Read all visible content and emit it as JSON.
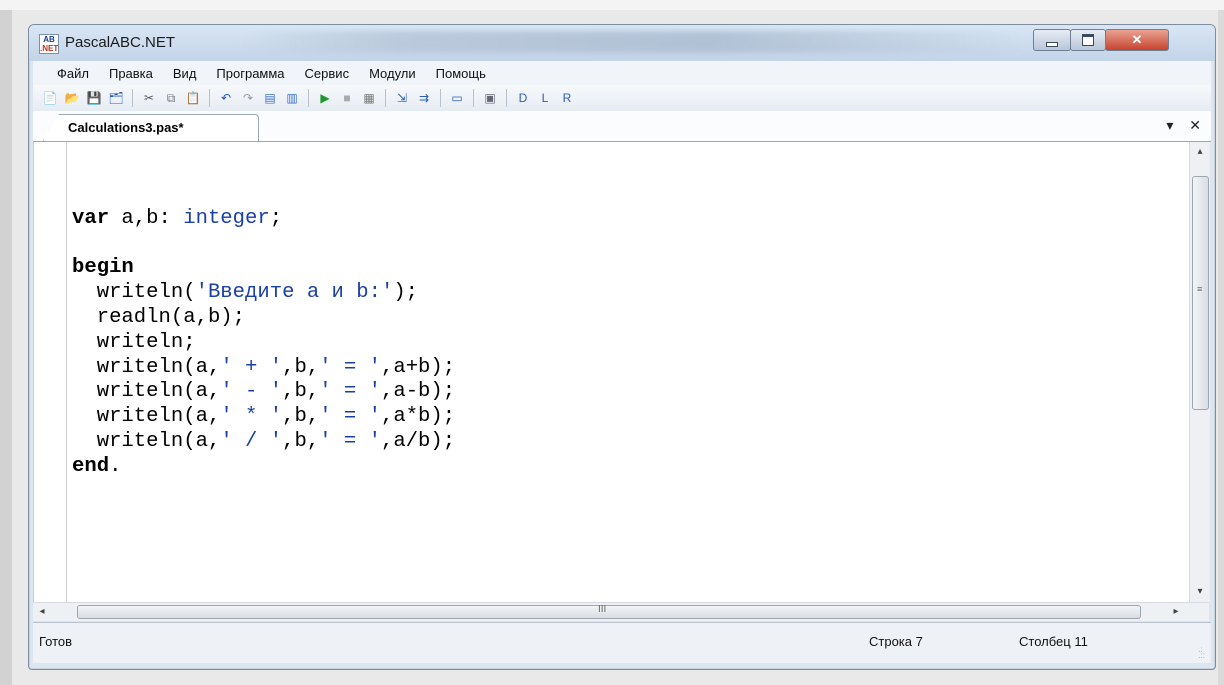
{
  "window": {
    "title": "PascalABC.NET",
    "icon_top": "AB",
    "icon_bottom": ".NET"
  },
  "controls": {
    "minimize": "minimize-icon",
    "maximize": "maximize-icon",
    "close": "✕"
  },
  "menu": [
    "Файл",
    "Правка",
    "Вид",
    "Программа",
    "Сервис",
    "Модули",
    "Помощь"
  ],
  "toolbar": [
    {
      "icon": "new-file-icon",
      "glyph": "📄",
      "color": "#d8b850"
    },
    {
      "icon": "open-folder-icon",
      "glyph": "📂",
      "color": "#d49a2a"
    },
    {
      "icon": "save-icon",
      "glyph": "💾",
      "color": "#2a5fb3"
    },
    {
      "icon": "save-all-icon",
      "glyph": "🗂",
      "color": "#2a5fb3"
    },
    {
      "sep": true
    },
    {
      "icon": "cut-icon",
      "glyph": "✂",
      "color": "#555"
    },
    {
      "icon": "copy-icon",
      "glyph": "⧉",
      "color": "#777"
    },
    {
      "icon": "paste-icon",
      "glyph": "📋",
      "color": "#a0722a"
    },
    {
      "sep": true
    },
    {
      "icon": "undo-icon",
      "glyph": "↶",
      "color": "#1d56c9"
    },
    {
      "icon": "redo-icon",
      "glyph": "↷",
      "color": "#999"
    },
    {
      "icon": "find-icon",
      "glyph": "▤",
      "color": "#3a6fd0"
    },
    {
      "icon": "replace-icon",
      "glyph": "▥",
      "color": "#3a6fd0"
    },
    {
      "sep": true
    },
    {
      "icon": "run-icon",
      "glyph": "▶",
      "color": "#1a9a2a"
    },
    {
      "icon": "stop-icon",
      "glyph": "■",
      "color": "#aaa"
    },
    {
      "icon": "compile-icon",
      "glyph": "▦",
      "color": "#777"
    },
    {
      "sep": true
    },
    {
      "icon": "step-into-icon",
      "glyph": "⇲",
      "color": "#2a5fb3"
    },
    {
      "icon": "step-over-icon",
      "glyph": "⇉",
      "color": "#2a5fb3"
    },
    {
      "sep": true
    },
    {
      "icon": "console-icon",
      "glyph": "▭",
      "color": "#2a5fb3"
    },
    {
      "sep": true
    },
    {
      "icon": "form-icon",
      "glyph": "▣",
      "color": "#667"
    },
    {
      "sep": true
    },
    {
      "icon": "debug-d-icon",
      "glyph": "D",
      "color": "#2a5fb3"
    },
    {
      "icon": "debug-l-icon",
      "glyph": "L",
      "color": "#2a5fb3"
    },
    {
      "icon": "debug-r-icon",
      "glyph": "R",
      "color": "#2a5fb3"
    }
  ],
  "tab": {
    "label": "Calculations3.pas*",
    "dropdown": "▾",
    "close": "✕"
  },
  "code": [
    [],
    [
      {
        "t": "var",
        "c": "kw"
      },
      {
        "t": " a,b: "
      },
      {
        "t": "integer",
        "c": "ty"
      },
      {
        "t": ";"
      }
    ],
    [],
    [
      {
        "t": "begin",
        "c": "kw"
      }
    ],
    [
      {
        "t": "  writeln("
      },
      {
        "t": "'Введите a и b:'",
        "c": "st"
      },
      {
        "t": ");"
      }
    ],
    [
      {
        "t": "  readln(a,b);"
      }
    ],
    [
      {
        "t": "  writeln;"
      }
    ],
    [
      {
        "t": "  writeln(a,"
      },
      {
        "t": "' + '",
        "c": "st"
      },
      {
        "t": ",b,"
      },
      {
        "t": "' = '",
        "c": "st"
      },
      {
        "t": ",a+b);"
      }
    ],
    [
      {
        "t": "  writeln(a,"
      },
      {
        "t": "' - '",
        "c": "st"
      },
      {
        "t": ",b,"
      },
      {
        "t": "' = '",
        "c": "st"
      },
      {
        "t": ",a-b);"
      }
    ],
    [
      {
        "t": "  writeln(a,"
      },
      {
        "t": "' * '",
        "c": "st"
      },
      {
        "t": ",b,"
      },
      {
        "t": "' = '",
        "c": "st"
      },
      {
        "t": ",a*b);"
      }
    ],
    [
      {
        "t": "  writeln(a,"
      },
      {
        "t": "' / '",
        "c": "st"
      },
      {
        "t": ",b,"
      },
      {
        "t": "' = '",
        "c": "st"
      },
      {
        "t": ",a/b);"
      }
    ],
    [
      {
        "t": "end",
        "c": "kw"
      },
      {
        "t": "."
      }
    ]
  ],
  "status": {
    "text": "Готов",
    "row": "Строка 7",
    "col": "Столбец 11"
  },
  "scroll": {
    "up": "▴",
    "down": "▾",
    "left": "◂",
    "right": "▸",
    "grip": "≡",
    "hgrip": "III"
  }
}
